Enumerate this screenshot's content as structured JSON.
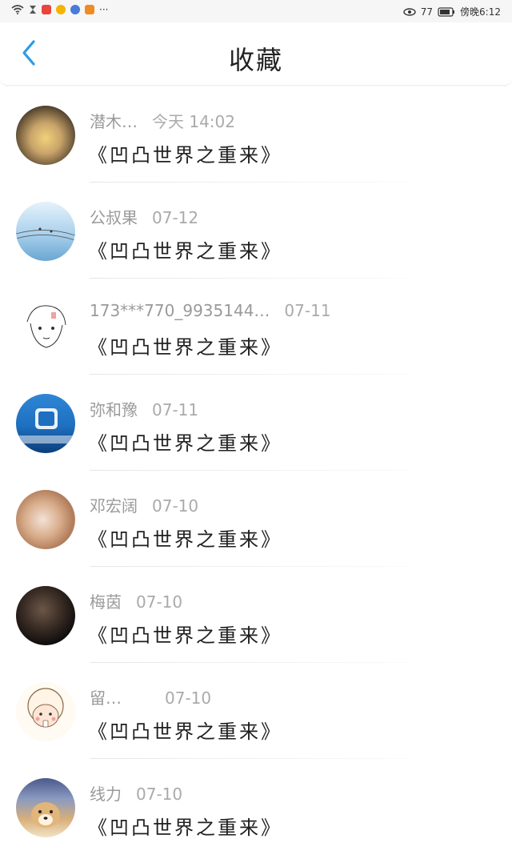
{
  "status_bar": {
    "dots": "···",
    "percent": "77",
    "clock": "傍晚6:12",
    "left_icons": [
      "wifi-icon",
      "hourglass-icon",
      "app-red-icon",
      "weibo-icon",
      "music-icon",
      "video-icon"
    ],
    "right_icons": [
      "eye-icon",
      "battery-icon"
    ]
  },
  "header": {
    "title": "收藏",
    "back_icon": "chevron-left-icon",
    "accent_color": "#2b9be8"
  },
  "items": [
    {
      "name": "潜木…",
      "time": "今天 14:02",
      "content": "《凹凸世界之重来》",
      "avatar": {
        "bg1": "#c9a46a",
        "bg2": "#3b2f22"
      }
    },
    {
      "name": "公叔果",
      "time": "07-12",
      "content": "《凹凸世界之重来》",
      "avatar": {
        "bg1": "#cfe6f5",
        "bg2": "#7fb2d8"
      }
    },
    {
      "name": "173***770_9935144…",
      "time": "07-11",
      "content": "《凹凸世界之重来》",
      "avatar": {
        "bg1": "#ffffff",
        "bg2": "#e8e8e8"
      }
    },
    {
      "name": "弥和豫",
      "time": "07-11",
      "content": "《凹凸世界之重来》",
      "avatar": {
        "bg1": "#1e6fbf",
        "bg2": "#0b3f7a"
      }
    },
    {
      "name": "邓宏阔",
      "time": "07-10",
      "content": "《凹凸世界之重来》",
      "avatar": {
        "bg1": "#e9d2c3",
        "bg2": "#c38f6a"
      }
    },
    {
      "name": "梅茵",
      "time": "07-10",
      "content": "《凹凸世界之重来》",
      "avatar": {
        "bg1": "#4a3a30",
        "bg2": "#101010"
      }
    },
    {
      "name": "留…",
      "time": "07-10",
      "content": "《凹凸世界之重来》",
      "avatar": {
        "bg1": "#fff4e6",
        "bg2": "#f2d6b3"
      }
    },
    {
      "name": "线力",
      "time": "07-10",
      "content": "《凹凸世界之重来》",
      "avatar": {
        "bg1": "#d9b07a",
        "bg2": "#4a5a8a"
      }
    }
  ]
}
